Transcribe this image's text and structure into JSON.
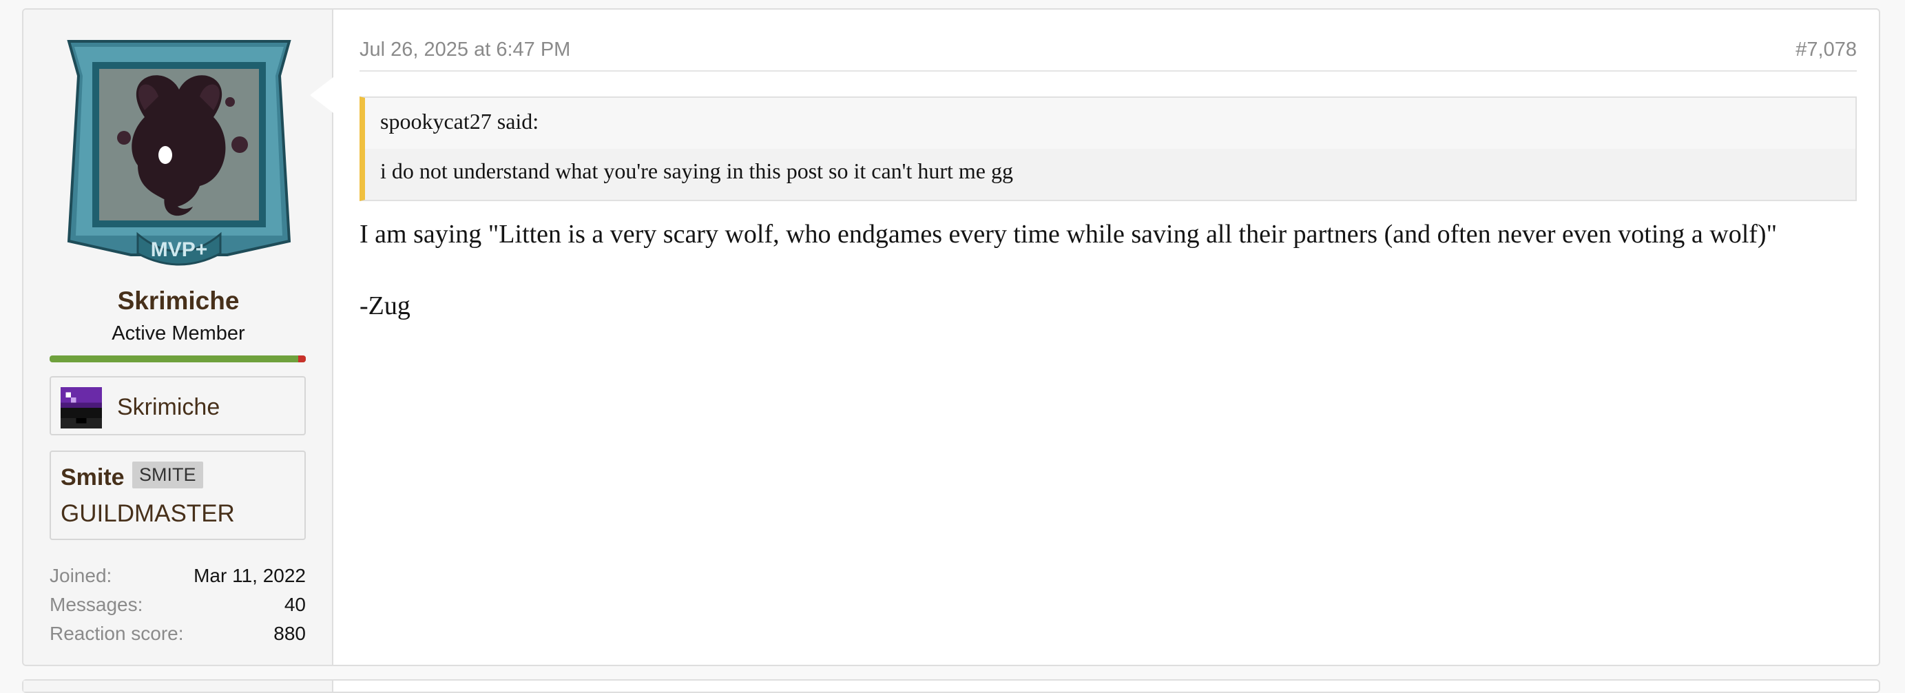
{
  "post": {
    "date": "Jul 26, 2025 at 6:47 PM",
    "number": "#7,078",
    "quote": {
      "header": "spookycat27 said:",
      "body": "i do not understand what you're saying in this post so it can't hurt me gg"
    },
    "message_lines": [
      "I am saying \"Litten is a very scary wolf, who endgames every time while saving all their partners (and often never even voting a wolf)\"",
      "-Zug"
    ]
  },
  "user": {
    "name": "Skrimiche",
    "title": "Active Member",
    "avatar_badge": "MVP+",
    "reputation": {
      "positive_fraction": 0.97,
      "positive_color": "#6fa13d",
      "negative_color": "#c8312a"
    },
    "minecraft_name": "Skrimiche",
    "guild": {
      "name": "Smite",
      "tag": "SMITE",
      "rank": "GUILDMASTER"
    },
    "stats": [
      {
        "label": "Joined:",
        "value": "Mar 11, 2022"
      },
      {
        "label": "Messages:",
        "value": "40"
      },
      {
        "label": "Reaction score:",
        "value": "880"
      }
    ]
  },
  "colors": {
    "username": "#47301a",
    "quote_border": "#f0c040",
    "frame": "#4f97a8"
  }
}
